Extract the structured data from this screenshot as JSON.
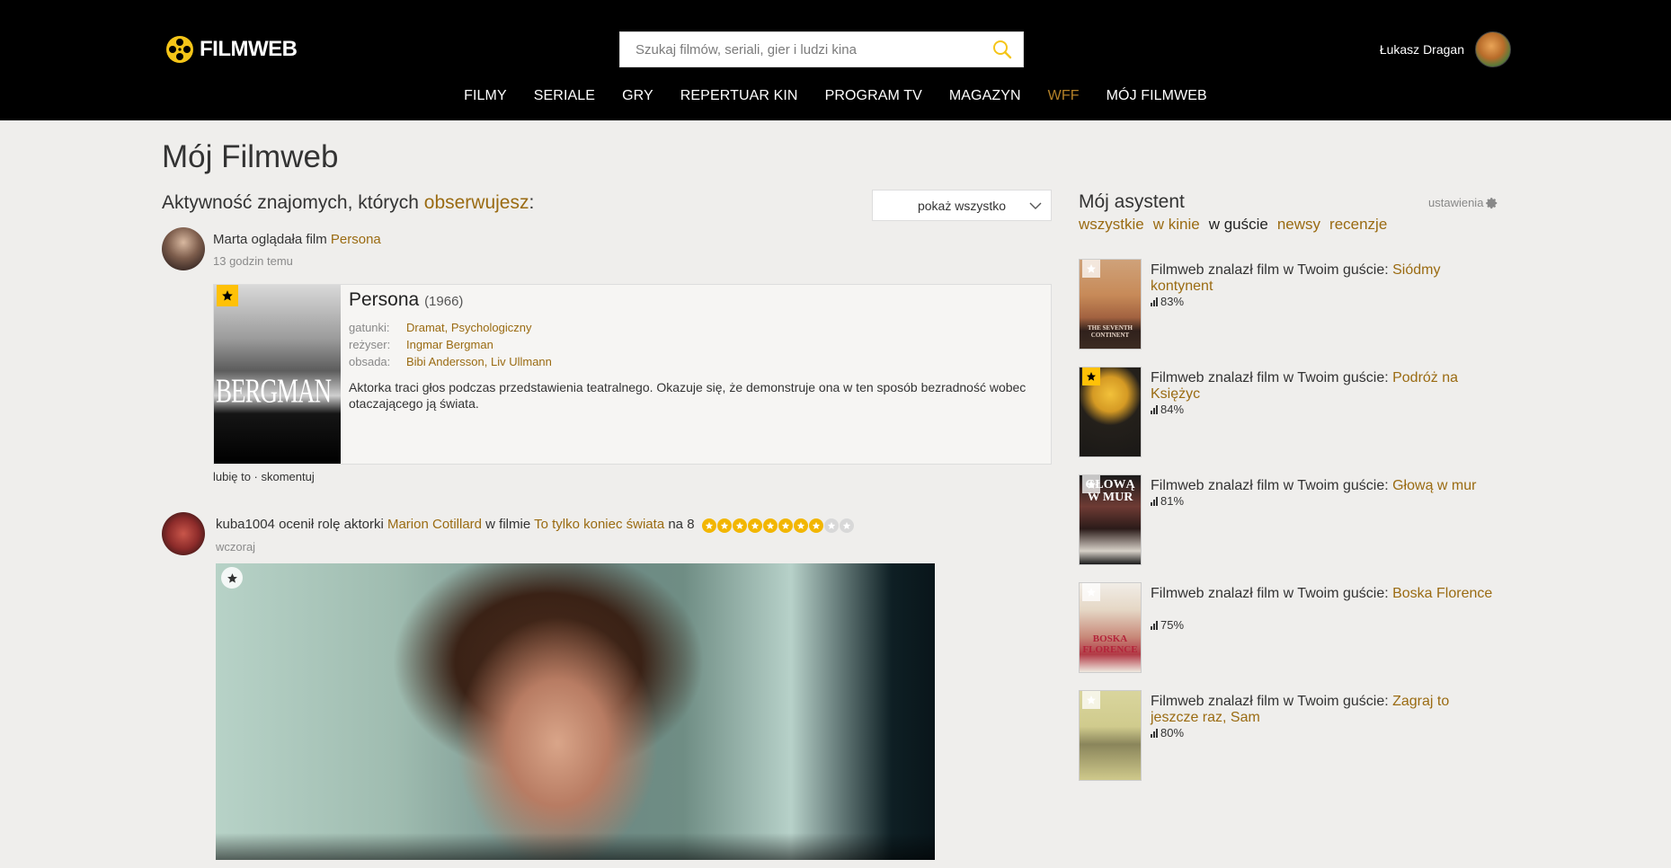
{
  "header": {
    "logo_text": "FILMWEB",
    "search_placeholder": "Szukaj filmów, seriali, gier i ludzi kina",
    "user_name": "Łukasz Dragan",
    "nav": [
      {
        "label": "FILMY"
      },
      {
        "label": "SERIALE"
      },
      {
        "label": "GRY"
      },
      {
        "label": "REPERTUAR KIN"
      },
      {
        "label": "PROGRAM TV"
      },
      {
        "label": "MAGAZYN"
      },
      {
        "label": "WFF"
      },
      {
        "label": "MÓJ FILMWEB"
      }
    ]
  },
  "page": {
    "title": "Mój Filmweb",
    "activity_prefix": "Aktywność znajomych, których ",
    "activity_link": "obserwujesz",
    "activity_suffix": ":",
    "filter_label": "pokaż wszystko"
  },
  "feed": [
    {
      "user": "Marta",
      "action": " oglądała film ",
      "film_link": "Persona",
      "time": "13 godzin temu",
      "card": {
        "title": "Persona",
        "year": "(1966)",
        "poster_text": "BERGMAN",
        "genres_label": "gatunki:",
        "genres": [
          "Dramat",
          "Psychologiczny"
        ],
        "director_label": "reżyser:",
        "director": "Ingmar Bergman",
        "cast_label": "obsada:",
        "cast": [
          "Bibi Andersson",
          "Liv Ullmann"
        ],
        "description": "Aktorka traci głos podczas przedstawienia teatralnego. Okazuje się, że demonstruje ona w ten sposób bezradność wobec otaczającego ją świata."
      },
      "like": "lubię to",
      "separator": " · ",
      "comment": "skomentuj"
    },
    {
      "user": "kuba1004",
      "action": " ocenił rolę aktorki ",
      "actor_link": "Marion Cotillard",
      "mid": " w filmie ",
      "film_link": "To tylko koniec świata",
      "rating_prefix": " na 8",
      "rating": 8,
      "rating_max": 10,
      "time": "wczoraj"
    }
  ],
  "sidebar": {
    "title": "Mój asystent",
    "settings": "ustawienia",
    "tabs": [
      {
        "label": "wszystkie",
        "active": false
      },
      {
        "label": "w kinie",
        "active": false
      },
      {
        "label": "w guście",
        "active": true
      },
      {
        "label": "newsy",
        "active": false
      },
      {
        "label": "recenzje",
        "active": false
      }
    ],
    "rec_prefix": "Filmweb znalazł film w Twoim guście: ",
    "recommendations": [
      {
        "title": "Siódmy kontynent",
        "score": "83%",
        "poster_text": "THE SEVENTH CONTINENT"
      },
      {
        "title": "Podróż na Księżyc",
        "score": "84%",
        "poster_text": ""
      },
      {
        "title": "Głową w mur",
        "score": "81%",
        "poster_text": "GŁOWĄ W MUR"
      },
      {
        "title": "Boska Florence",
        "score": "75%",
        "poster_text": "BOSKA FLORENCE"
      },
      {
        "title": "Zagraj to jeszcze raz, Sam",
        "score": "80%",
        "poster_text": ""
      }
    ]
  },
  "colors": {
    "accent_link": "#9a6b12",
    "header_bg": "#000000",
    "page_bg": "#efeeec",
    "rating_star": "#f2b600",
    "badge_gold": "#ffc107"
  }
}
